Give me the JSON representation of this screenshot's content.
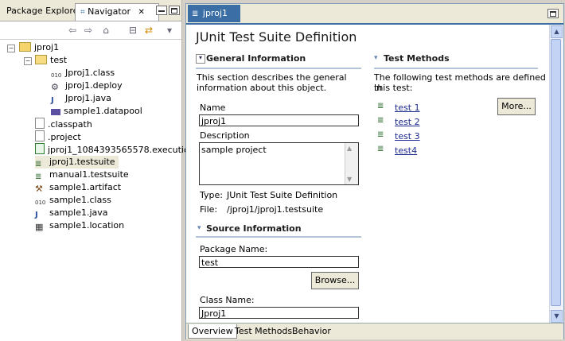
{
  "left_panel": {
    "tabs": [
      "Package Explorer",
      "Navigator"
    ],
    "tree": [
      {
        "label": "jproj1",
        "icon": "project-folder-icon",
        "expanded": true
      },
      {
        "label": "test",
        "icon": "folder-icon",
        "expanded": true
      },
      {
        "label": "Jproj1.class",
        "icon": "class-file-icon"
      },
      {
        "label": "jproj1.deploy",
        "icon": "deploy-icon"
      },
      {
        "label": "Jproj1.java",
        "icon": "java-file-icon"
      },
      {
        "label": "sample1.datapool",
        "icon": "datapool-icon"
      },
      {
        "label": ".classpath",
        "icon": "file-icon"
      },
      {
        "label": ".project",
        "icon": "file-icon"
      },
      {
        "label": "jproj1_1084393565578.execution",
        "icon": "execution-icon"
      },
      {
        "label": "jproj1.testsuite",
        "icon": "testsuite-icon",
        "selected": true
      },
      {
        "label": "manual1.testsuite",
        "icon": "testsuite-icon"
      },
      {
        "label": "sample1.artifact",
        "icon": "artifact-icon"
      },
      {
        "label": "sample1.class",
        "icon": "class-file-icon"
      },
      {
        "label": "sample1.java",
        "icon": "java-file-icon"
      },
      {
        "label": "sample1.location",
        "icon": "location-icon"
      }
    ]
  },
  "editor": {
    "tab_label": "jproj1",
    "title": "JUnit Test Suite Definition",
    "general": {
      "heading": "General Information",
      "description_line1": "This section describes the general",
      "description_line2": "information about this object.",
      "name_label": "Name",
      "name_value": "jproj1",
      "desc_label": "Description",
      "desc_value": "sample project",
      "type_label": "Type:",
      "type_value": "JUnit Test Suite Definition",
      "file_label": "File:",
      "file_value": "/jproj1/jproj1.testsuite"
    },
    "source": {
      "heading": "Source Information",
      "package_label": "Package Name:",
      "package_value": "test",
      "browse_label": "Browse...",
      "class_label": "Class Name:",
      "class_value": "Jproj1"
    },
    "methods": {
      "heading": "Test Methods",
      "description_line1": "The following test methods are defined in",
      "description_line2": "this test:",
      "items": [
        "test 1",
        "test 2",
        "test 3",
        "test4"
      ],
      "more_label": "More..."
    },
    "bottom_tabs": [
      "Overview",
      "Test Methods",
      "Behavior"
    ]
  }
}
